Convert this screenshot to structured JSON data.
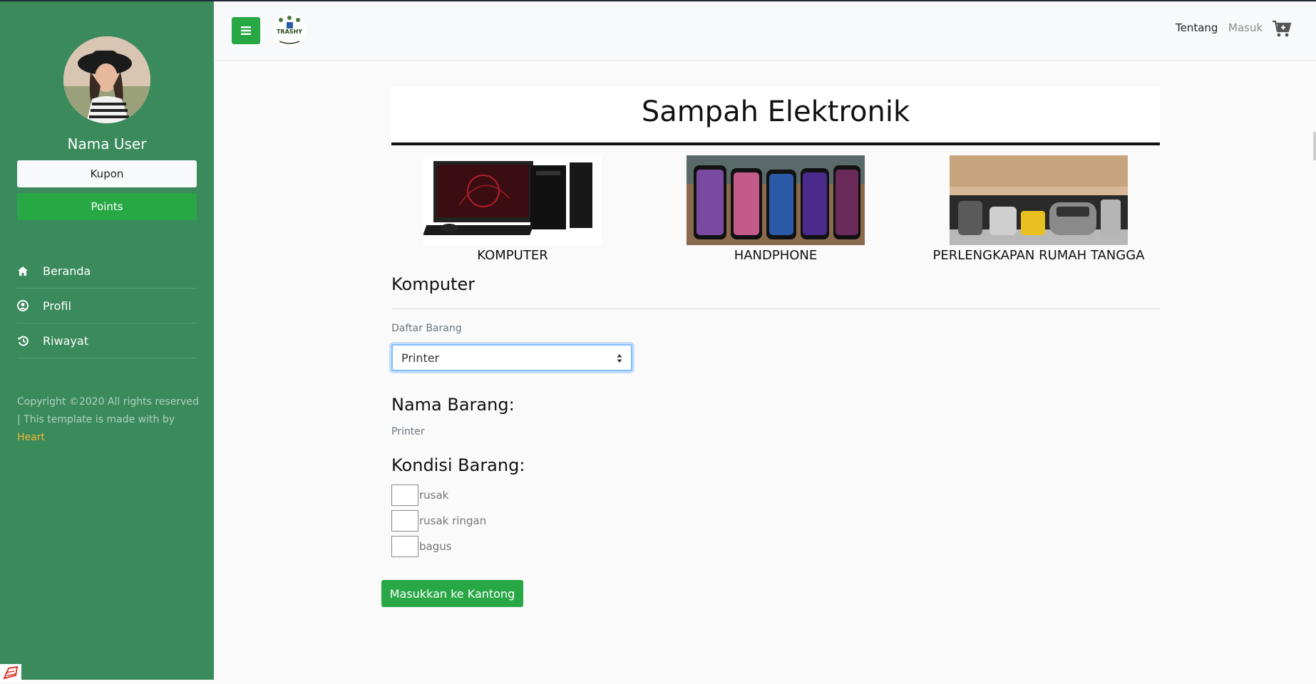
{
  "sidebar": {
    "username": "Nama User",
    "kupon_label": "Kupon",
    "points_label": "Points",
    "menu": [
      {
        "label": "Beranda",
        "icon": "home-icon"
      },
      {
        "label": "Profil",
        "icon": "user-circle-icon"
      },
      {
        "label": "Riwayat",
        "icon": "history-icon"
      }
    ],
    "copyright_text": "Copyright ©2020 All rights reserved | This template is made with by ",
    "copyright_link": "Heart"
  },
  "topbar": {
    "nav": {
      "tentang": "Tentang",
      "masuk": "Masuk"
    },
    "icons": [
      "menu-icon",
      "trashy-logo",
      "cart-plus-icon"
    ],
    "logo_text": "TRASHY"
  },
  "main": {
    "title": "Sampah Elektronik",
    "categories": [
      {
        "label": "KOMPUTER",
        "image": "computer-image"
      },
      {
        "label": "HANDPHONE",
        "image": "phones-image"
      },
      {
        "label": "PERLENGKAPAN RUMAH TANGGA",
        "image": "kitchen-appliances-image"
      }
    ],
    "section_title": "Komputer",
    "list_label": "Daftar Barang",
    "selected_item": "Printer",
    "nama_heading": "Nama Barang:",
    "nama_value": "Printer",
    "kondisi_heading": "Kondisi Barang:",
    "kondisi_options": [
      "rusak",
      "rusak ringan",
      "bagus"
    ],
    "submit_label": "Masukkan ke Kantong"
  },
  "colors": {
    "sidebar_bg": "#3a8a5c",
    "accent_green": "#28a745",
    "link_heart": "#f7b733"
  }
}
